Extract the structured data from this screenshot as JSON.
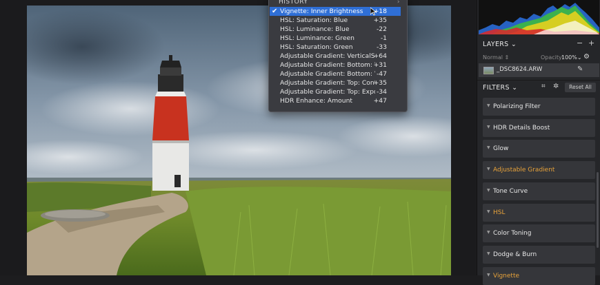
{
  "history": {
    "title": "HISTORY",
    "items": [
      {
        "label": "Vignette: Inner Brightness",
        "value": "+18",
        "selected": true
      },
      {
        "label": "HSL: Saturation: Blue",
        "value": "+35"
      },
      {
        "label": "HSL: Luminance: Blue",
        "value": "-22"
      },
      {
        "label": "HSL: Luminance: Green",
        "value": "-1"
      },
      {
        "label": "HSL: Saturation: Green",
        "value": "-33"
      },
      {
        "label": "Adjustable Gradient: VerticalShift",
        "value": "+64"
      },
      {
        "label": "Adjustable Gradient: Bottom: Wa...",
        "value": "+31"
      },
      {
        "label": "Adjustable Gradient: Bottom: Vib...",
        "value": "-47"
      },
      {
        "label": "Adjustable Gradient: Top: Contr...",
        "value": "+35"
      },
      {
        "label": "Adjustable Gradient: Top: Expos...",
        "value": "-34"
      },
      {
        "label": "HDR Enhance: Amount",
        "value": "+47"
      }
    ]
  },
  "layers": {
    "title": "LAYERS",
    "blend_mode": "Normal",
    "opacity_label": "Opacity:",
    "opacity_value": "100%",
    "layer_name": "_DSC8624.ARW"
  },
  "filters": {
    "title": "FILTERS",
    "reset_label": "Reset All",
    "items": [
      {
        "label": "Polarizing Filter",
        "accent": false
      },
      {
        "label": "HDR Details Boost",
        "accent": false
      },
      {
        "label": "Glow",
        "accent": false
      },
      {
        "label": "Adjustable Gradient",
        "accent": true
      },
      {
        "label": "Tone Curve",
        "accent": false
      },
      {
        "label": "HSL",
        "accent": true
      },
      {
        "label": "Color Toning",
        "accent": false
      },
      {
        "label": "Dodge & Burn",
        "accent": false
      },
      {
        "label": "Vignette",
        "accent": true
      }
    ]
  },
  "colors": {
    "accent": "#e8a33a",
    "selection": "#2f6fd6"
  }
}
